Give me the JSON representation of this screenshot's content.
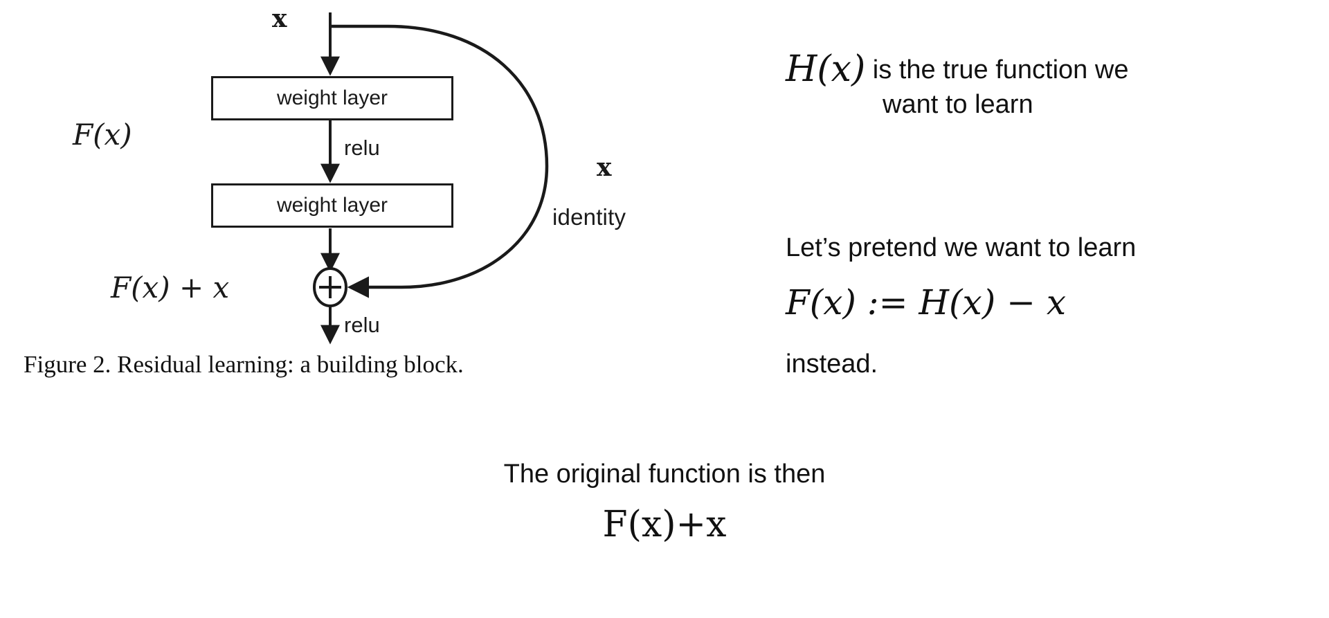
{
  "figure": {
    "diagram": {
      "input_label": "x",
      "boxes": [
        {
          "label": "weight layer"
        },
        {
          "label": "weight layer"
        }
      ],
      "relu_mid_label": "relu",
      "relu_out_label": "relu",
      "residual_label": "F(x)",
      "output_label": "F(x) + x",
      "skip_label_x": "x",
      "skip_label_identity": "identity"
    },
    "caption": "Figure 2. Residual learning: a building block."
  },
  "notes": {
    "line1_math": "H(x)",
    "line1_text": " is the true function we",
    "line2_text": "want to learn",
    "line3_text": "Let’s pretend we want to learn",
    "line4_formula": "F(x) := H(x) − x",
    "line5_text": "instead."
  },
  "bottom": {
    "text": "The original function is then",
    "formula": "F(x)+x"
  },
  "colors": {
    "ink": "#1a1a1a",
    "text": "#111111",
    "background": "#ffffff"
  }
}
